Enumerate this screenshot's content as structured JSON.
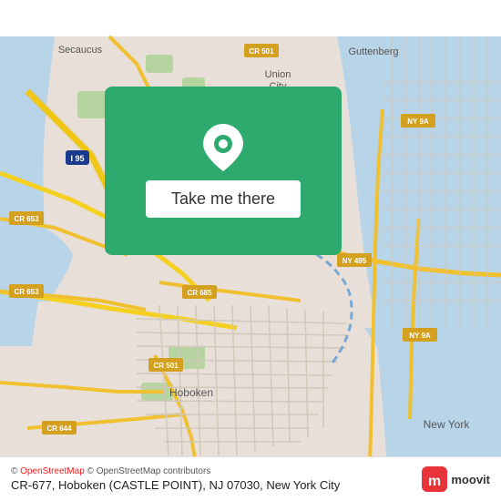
{
  "map": {
    "background_color": "#e8e0d8",
    "center_lat": 40.745,
    "center_lon": -74.025
  },
  "action_panel": {
    "background_color": "#2eaa6e",
    "button_label": "Take me there",
    "location_icon": "map-pin-icon"
  },
  "info_bar": {
    "attribution_text": "© OpenStreetMap contributors",
    "location_text": "CR-677, Hoboken (CASTLE POINT), NJ 07030, New York City",
    "logo_name": "moovit",
    "logo_text": "moovit"
  }
}
